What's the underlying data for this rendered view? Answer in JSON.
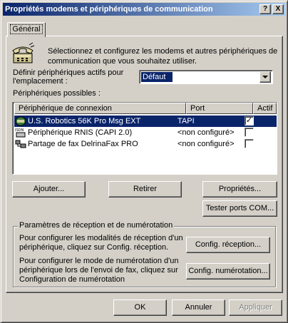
{
  "window": {
    "title": "Propriétés modems et périphériques de communication",
    "help_btn": "?",
    "close_btn": "X"
  },
  "tabs": [
    {
      "label": "Général"
    }
  ],
  "intro_text_1": "Sélectionnez et configurez les modems et autres périphériques de",
  "intro_text_2": "communication que vous souhaitez utiliser.",
  "location": {
    "label_1": "Définir périphériques actifs pour",
    "label_2": "l'emplacement :",
    "value": "Défaut"
  },
  "devices": {
    "label": "Périphériques possibles :",
    "columns": {
      "device": "Périphérique de connexion",
      "port": "Port",
      "active": "Actif"
    },
    "rows": [
      {
        "name": "U.S. Robotics 56K Pro Msg EXT",
        "port": "TAPI",
        "active": true,
        "icon": "modem-icon"
      },
      {
        "name": "Périphérique RNIS (CAPI 2.0)",
        "port": "<non configuré>",
        "active": false,
        "icon": "isdn-icon"
      },
      {
        "name": "Partage de fax DelrinaFax PRO",
        "port": "<non configuré>",
        "active": false,
        "icon": "fax-share-icon"
      }
    ]
  },
  "buttons": {
    "add": "Ajouter...",
    "remove": "Retirer",
    "properties": "Propriétés...",
    "test_ports": "Tester ports COM...",
    "config_reception": "Config. réception...",
    "config_dialing": "Config. numérotation...",
    "ok": "OK",
    "cancel": "Annuler",
    "apply": "Appliquer"
  },
  "reception_group": {
    "title": "Paramètres de réception et de numérotation",
    "reception_text": [
      "Pour configurer les modalités de réception d'un",
      "périphérique, cliquez sur Config. réception."
    ],
    "dialing_text": [
      "Pour configurer le mode de numérotation d'un",
      "périphérique lors de l'envoi de fax, cliquez sur",
      "Configuration de numérotation"
    ]
  },
  "colors": {
    "selection": "#0a246a",
    "title_start": "#0a246a",
    "title_end": "#a6caf0",
    "face": "#d4d0c8"
  }
}
